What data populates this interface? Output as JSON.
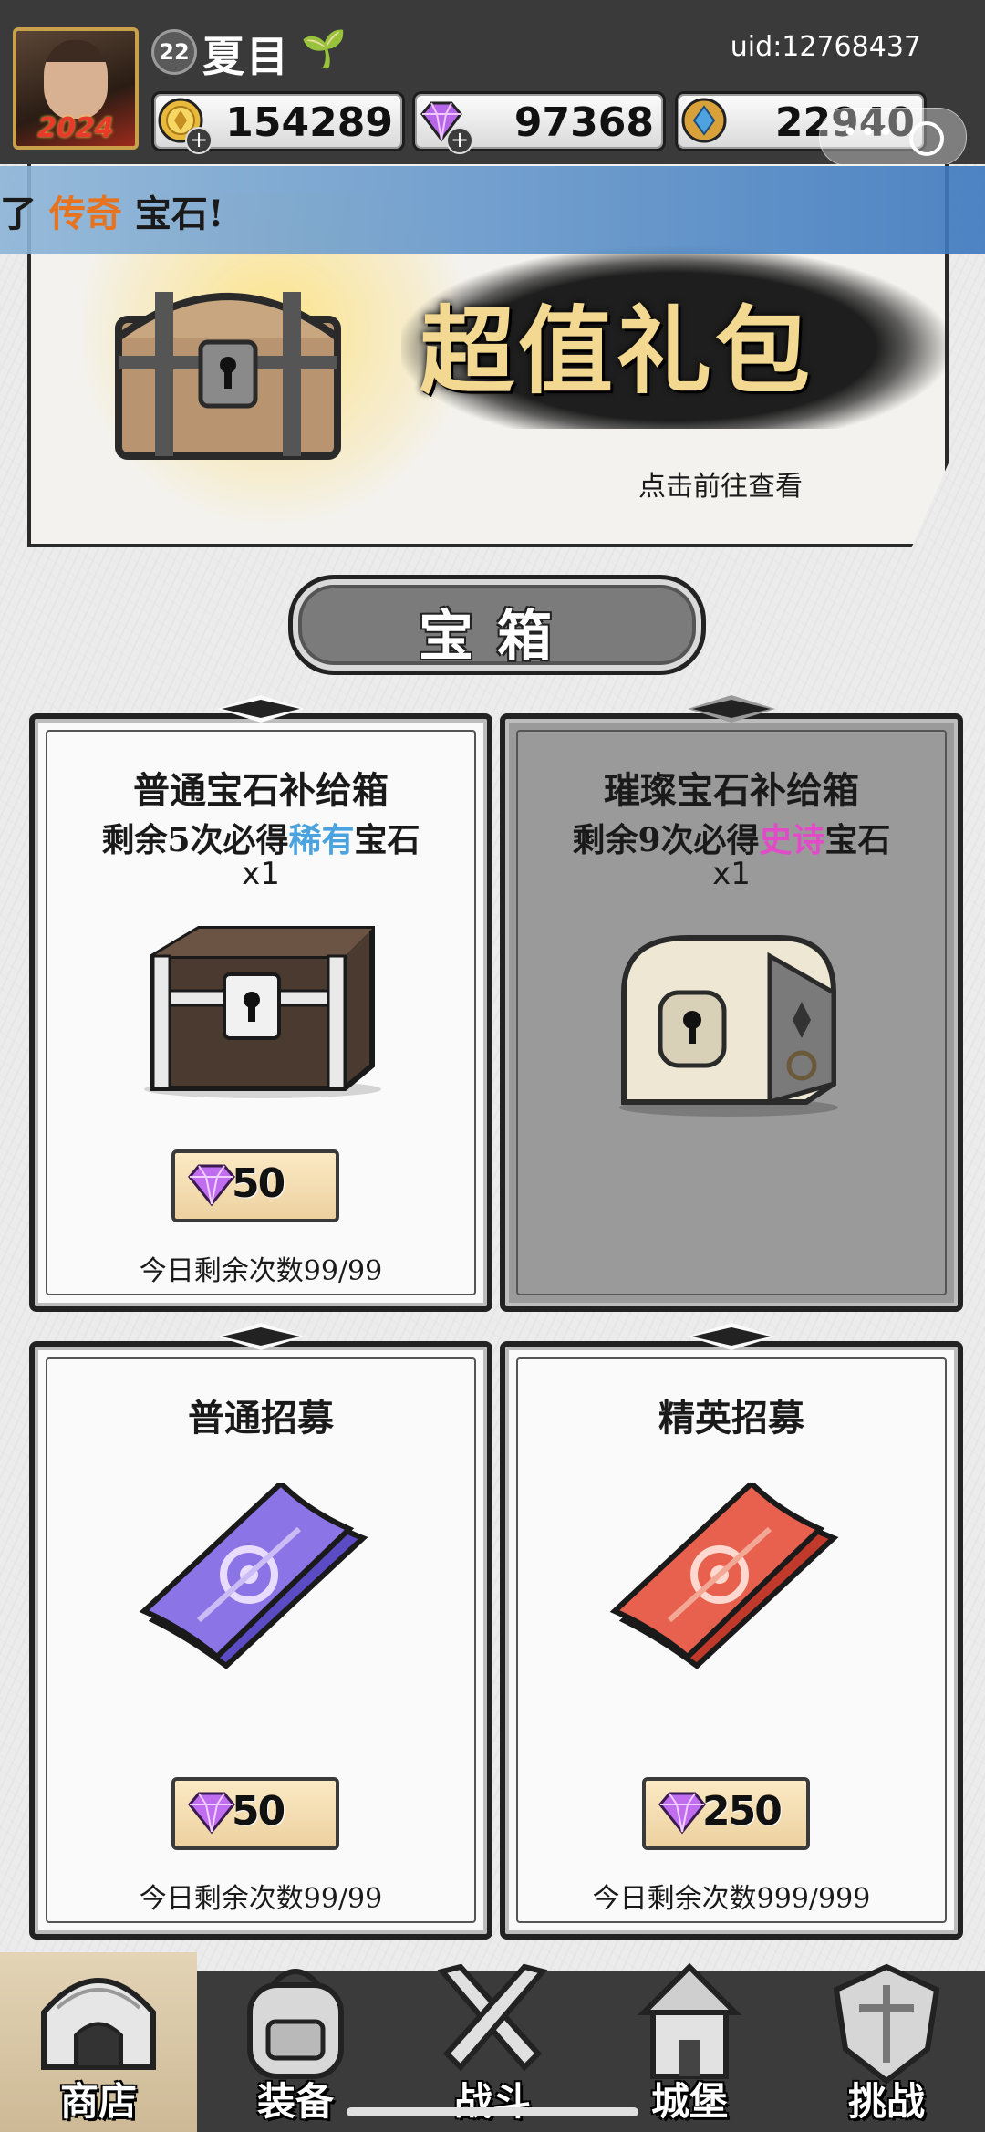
{
  "header": {
    "level": "22",
    "player_name": "夏目",
    "uid": "uid:12768437",
    "avatar_year": "2024",
    "resources": [
      {
        "icon": "gold-coin-icon",
        "value": "154289"
      },
      {
        "icon": "purple-gem-icon",
        "value": "97368"
      },
      {
        "icon": "blue-crystal-icon",
        "value": "22940"
      }
    ]
  },
  "marquee": {
    "prefix": "了",
    "highlight": "传奇",
    "suffix": "宝石!"
  },
  "banner": {
    "title": "超值礼包",
    "subtitle": "点击前往查看"
  },
  "section": {
    "title": "宝箱"
  },
  "cards": [
    {
      "title": "普通宝石补给箱",
      "line_pre": "剩余5次必得",
      "line_hl": "稀有",
      "line_post": "宝石",
      "qty": "x1",
      "price": "50",
      "daily": "今日剩余次数99/99"
    },
    {
      "title": "璀璨宝石补给箱",
      "line_pre": "剩余9次必得",
      "line_hl": "史诗",
      "line_post": "宝石",
      "qty": "x1"
    },
    {
      "title": "普通招募",
      "price": "50",
      "daily": "今日剩余次数99/99"
    },
    {
      "title": "精英招募",
      "price": "250",
      "daily": "今日剩余次数999/999"
    }
  ],
  "nav": [
    {
      "label": "商店",
      "active": true
    },
    {
      "label": "装备"
    },
    {
      "label": "战斗"
    },
    {
      "label": "城堡"
    },
    {
      "label": "挑战"
    }
  ],
  "colors": {
    "rare_blue": "#4aa3de",
    "epic_pink": "#e24bc7",
    "banner_gold": "#f3d891",
    "marquee_orange": "#e8731e"
  }
}
